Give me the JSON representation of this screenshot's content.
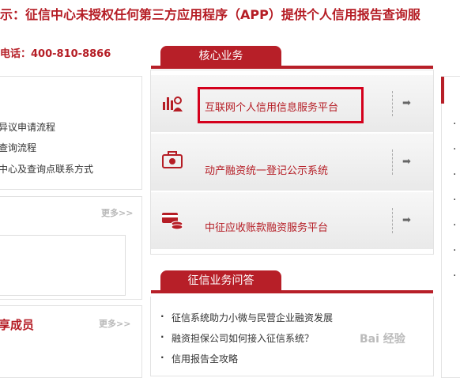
{
  "header": {
    "notice": "示：征信中心未授权任何第三方应用程序（APP）提供个人信用报告查询服",
    "phone": "电话：400-810-8866"
  },
  "left": {
    "process_items": [
      "异议申请流程",
      "查询流程",
      "中心及查询点联系方式"
    ],
    "more_label_1": "更多>>",
    "members_title": "享成员",
    "more_label_2": "更多>>"
  },
  "core_business": {
    "tab_label": "核心业务",
    "services": [
      {
        "label": "互联网个人信用信息服务平台",
        "icon": "chart-person-icon"
      },
      {
        "label": "动产融资统一登记公示系统",
        "icon": "certificate-icon"
      },
      {
        "label": "中征应收账款融资服务平台",
        "icon": "card-coins-icon"
      }
    ],
    "arrow": "➡"
  },
  "qa": {
    "tab_label": "征信业务问答",
    "items": [
      "征信系统助力小微与民营企业融资发展",
      "融资担保公司如何接入征信系统？",
      "信用报告全攻略"
    ]
  },
  "watermark": "Bai 经验",
  "colors": {
    "brand_red": "#b71f28",
    "highlight_red": "#d4001c"
  }
}
